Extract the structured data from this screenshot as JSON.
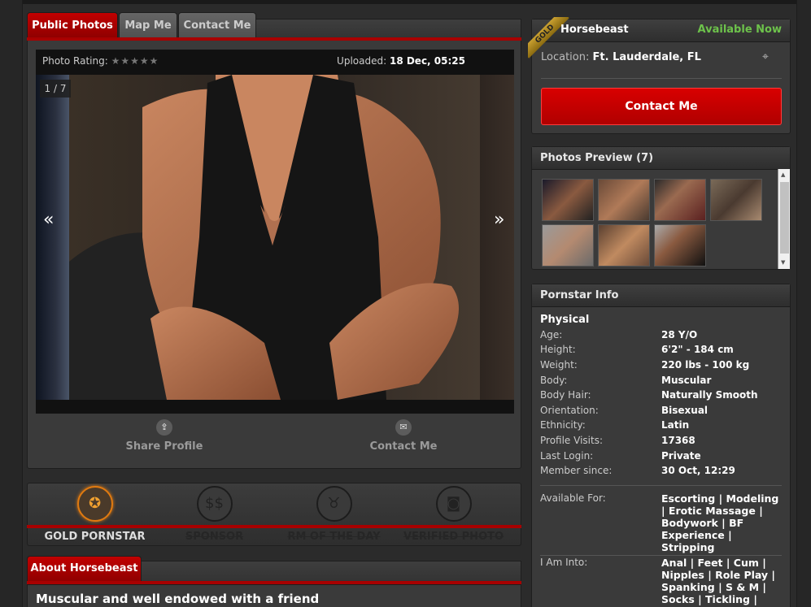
{
  "tabs": [
    {
      "label": "Public Photos",
      "active": true
    },
    {
      "label": "Map Me",
      "active": false
    },
    {
      "label": "Contact Me",
      "active": false
    }
  ],
  "photo": {
    "rating_label": "Photo Rating:",
    "stars": "★★★★★",
    "uploaded_label": "Uploaded:",
    "uploaded_value": "18 Dec, 05:25",
    "counter": "1 / 7",
    "prev": "«",
    "next": "»"
  },
  "actions": {
    "share": "Share Profile",
    "contact": "Contact Me"
  },
  "badges": [
    {
      "label": "GOLD PORNSTAR",
      "earned": true,
      "icon": "award-icon"
    },
    {
      "label": "SPONSOR",
      "earned": false,
      "icon": "dollar-icon"
    },
    {
      "label": "RM OF THE DAY",
      "earned": false,
      "icon": "horns-icon"
    },
    {
      "label": "VERIFIED PHOTO",
      "earned": false,
      "icon": "camera-icon"
    }
  ],
  "about": {
    "tab_label": "About Horsebeast",
    "headline": "Muscular and well endowed with a friend"
  },
  "profile": {
    "ribbon": "GOLD",
    "name": "Horsebeast",
    "availability": "Available Now",
    "location_label": "Location:",
    "location": "Ft. Lauderdale, FL",
    "contact_button": "Contact Me"
  },
  "photos_preview": {
    "title": "Photos Preview (7)",
    "count": 7
  },
  "info": {
    "title": "Pornstar Info",
    "section": "Physical",
    "rows": [
      {
        "k": "Age:",
        "v": "28 Y/O"
      },
      {
        "k": "Height:",
        "v": "6'2\" - 184 cm"
      },
      {
        "k": "Weight:",
        "v": "220 lbs - 100 kg"
      },
      {
        "k": "Body:",
        "v": "Muscular"
      },
      {
        "k": "Body Hair:",
        "v": "Naturally Smooth"
      },
      {
        "k": "Orientation:",
        "v": "Bisexual"
      },
      {
        "k": "Ethnicity:",
        "v": "Latin"
      },
      {
        "k": "Profile Visits:",
        "v": "17368"
      },
      {
        "k": "Last Login:",
        "v": "Private"
      },
      {
        "k": "Member since:",
        "v": "30 Oct, 12:29"
      }
    ],
    "available_for_label": "Available For:",
    "available_for": [
      "Escorting | Modeling",
      "| Erotic Massage |",
      "Bodywork | BF",
      "Experience |",
      "Stripping"
    ],
    "into_label": "I Am Into:",
    "into": [
      "Anal | Feet | Cum |",
      "Nipples | Role Play |",
      "Spanking | S & M |",
      "Socks | Tickling |"
    ]
  },
  "colors": {
    "accent_red": "#b00000",
    "available_green": "#6dc24b",
    "gold": "#e07a10"
  }
}
